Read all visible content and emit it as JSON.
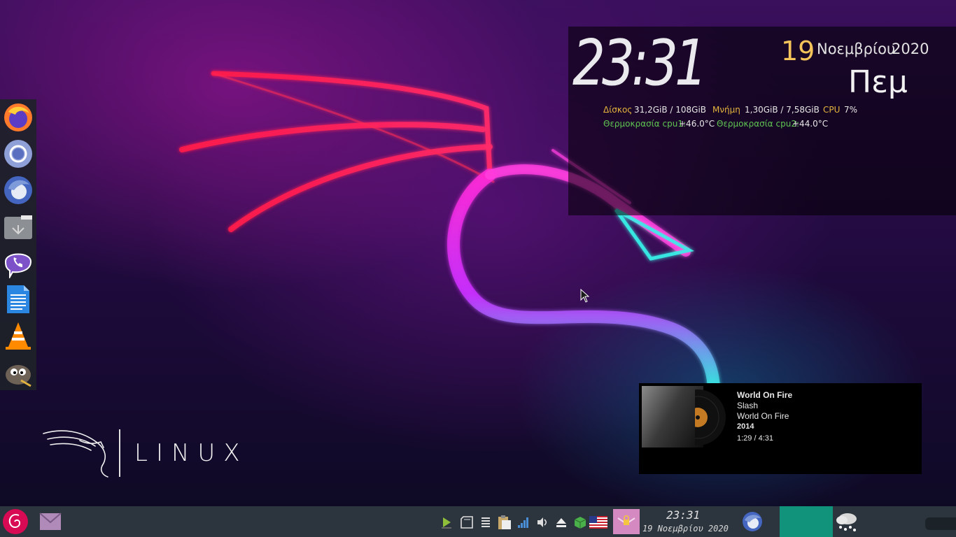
{
  "conky": {
    "time": "23:31",
    "day": "19",
    "month": "Νοεμβρίου",
    "year": "2020",
    "weekday": "Πεμ",
    "disk_label": "Δίσκος",
    "disk_value": "31,2GiB / 108GiB",
    "mem_label": "Μνήμη",
    "mem_value": "1,30GiB / 7,58GiB",
    "cpu_label": "CPU",
    "cpu_value": "7%",
    "temp1_label": "Θερμοκρασία cpu1:",
    "temp1_value": "+46.0°C",
    "temp2_label": "Θερμοκρασία cpu2:",
    "temp2_value": "+44.0°C"
  },
  "logo": {
    "text": "LINUX"
  },
  "media": {
    "title": "World On Fire",
    "artist": "Slash",
    "album": "World On Fire",
    "year": "2014",
    "position": "1:29 / 4:31"
  },
  "dock": {
    "items": [
      "firefox-icon",
      "chromium-icon",
      "thunderbird-icon",
      "file-manager-icon",
      "viber-icon",
      "text-editor-icon",
      "vlc-icon",
      "gimp-icon"
    ]
  },
  "taskbar": {
    "time": "23:31",
    "date": "19 Νοεμβρίου 2020"
  },
  "colors": {
    "accent_teal": "#11927a",
    "conky_yellow": "#e4b43c",
    "conky_green": "#5fc552",
    "taskbar_bg": "#2c353d"
  }
}
